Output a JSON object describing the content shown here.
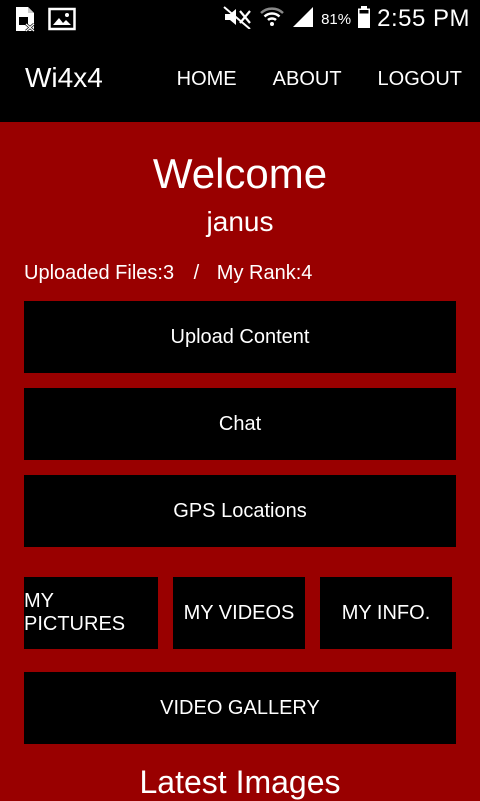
{
  "statusbar": {
    "battery_percent": "81%",
    "time": "2:55 PM"
  },
  "appbar": {
    "brand": "Wi4x4",
    "nav": {
      "home": "HOME",
      "about": "ABOUT",
      "logout": "LOGOUT"
    }
  },
  "main": {
    "welcome": "Welcome",
    "username": "janus",
    "uploaded_files": "Uploaded Files:3",
    "separator": "/",
    "my_rank": "My Rank:4",
    "buttons": {
      "upload_content": "Upload Content",
      "chat": "Chat",
      "gps_locations": "GPS Locations",
      "my_pictures": "MY PICTURES",
      "my_videos": "MY VIDEOS",
      "my_info": "MY INFO.",
      "video_gallery": "VIDEO GALLERY"
    },
    "latest_images": "Latest Images"
  },
  "colors": {
    "background": "#990000",
    "bars": "#000000",
    "text": "#ffffff"
  }
}
